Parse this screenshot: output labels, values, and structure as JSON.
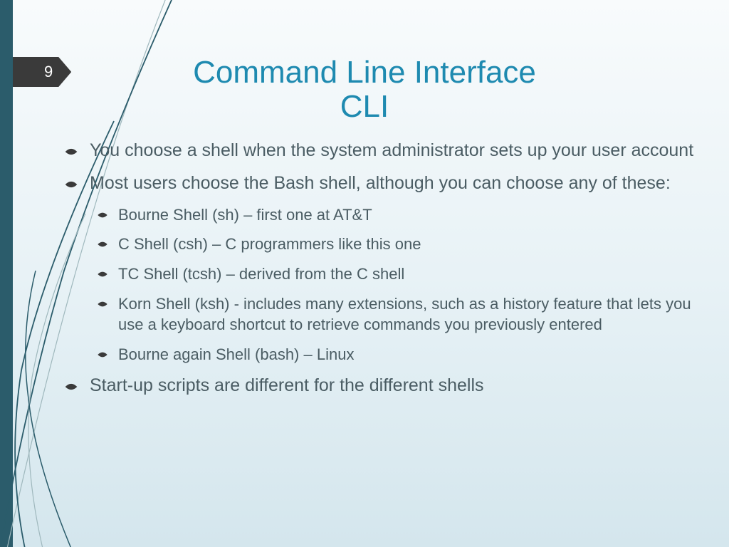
{
  "pageNumber": "9",
  "title": {
    "line1": "Command Line Interface",
    "line2": "CLI"
  },
  "bullets": [
    {
      "level": 1,
      "text": "You choose a shell when the system administrator sets up your user account"
    },
    {
      "level": 1,
      "text": "Most users choose the Bash shell, although you can choose any of these:"
    },
    {
      "level": 2,
      "text": "Bourne Shell (sh) – first one at AT&T"
    },
    {
      "level": 2,
      "text": "C Shell (csh) – C programmers like this one"
    },
    {
      "level": 2,
      "text": "TC Shell (tcsh) – derived from the C shell"
    },
    {
      "level": 2,
      "text": "Korn Shell (ksh) - includes many extensions, such as a history feature that lets you use a keyboard shortcut to retrieve commands you previously entered"
    },
    {
      "level": 2,
      "text": "Bourne again Shell (bash) – Linux"
    },
    {
      "level": 1,
      "text": "Start-up scripts are different for the different shells"
    }
  ]
}
